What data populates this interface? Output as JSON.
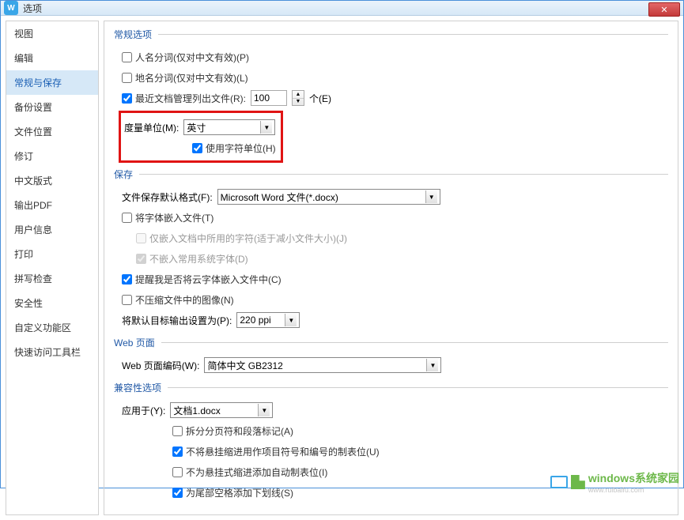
{
  "window": {
    "title": "选项"
  },
  "sidebar": {
    "items": [
      {
        "label": "视图"
      },
      {
        "label": "编辑"
      },
      {
        "label": "常规与保存",
        "selected": true
      },
      {
        "label": "备份设置"
      },
      {
        "label": "文件位置"
      },
      {
        "label": "修订"
      },
      {
        "label": "中文版式"
      },
      {
        "label": "输出PDF"
      },
      {
        "label": "用户信息"
      },
      {
        "label": "打印"
      },
      {
        "label": "拼写检查"
      },
      {
        "label": "安全性"
      },
      {
        "label": "自定义功能区"
      },
      {
        "label": "快速访问工具栏"
      }
    ]
  },
  "general": {
    "legend": "常规选项",
    "person_name_seg": "人名分词(仅对中文有效)(P)",
    "place_name_seg": "地名分词(仅对中文有效)(L)",
    "recent_files_label": "最近文档管理列出文件(R):",
    "recent_files_value": "100",
    "recent_files_unit": "个(E)",
    "unit_label": "度量单位(M):",
    "unit_value": "英寸",
    "use_char_unit": "使用字符单位(H)"
  },
  "save": {
    "legend": "保存",
    "default_format_label": "文件保存默认格式(F):",
    "default_format_value": "Microsoft Word 文件(*.docx)",
    "embed_fonts": "将字体嵌入文件(T)",
    "embed_fonts_only_used": "仅嵌入文档中所用的字符(适于减小文件大小)(J)",
    "embed_fonts_no_sys": "不嵌入常用系统字体(D)",
    "remind_cloud_fonts": "提醒我是否将云字体嵌入文件中(C)",
    "no_compress_images": "不压缩文件中的图像(N)",
    "default_target_label": "将默认目标输出设置为(P):",
    "default_target_value": "220 ppi"
  },
  "web": {
    "legend": "Web 页面",
    "encoding_label": "Web 页面编码(W):",
    "encoding_value": "简体中文 GB2312"
  },
  "compat": {
    "legend": "兼容性选项",
    "apply_to_label": "应用于(Y):",
    "apply_to_value": "文档1.docx",
    "split_page_break": "拆分分页符和段落标记(A)",
    "no_hanging_indent_tab": "不将悬挂缩进用作项目符号和编号的制表位(U)",
    "no_auto_tab_hanging": "不为悬挂式缩进添加自动制表位(I)",
    "underline_trailing_space": "为尾部空格添加下划线(S)"
  },
  "watermark": {
    "main": "windows系统家园",
    "sub": "www.ruibaifu.com"
  }
}
